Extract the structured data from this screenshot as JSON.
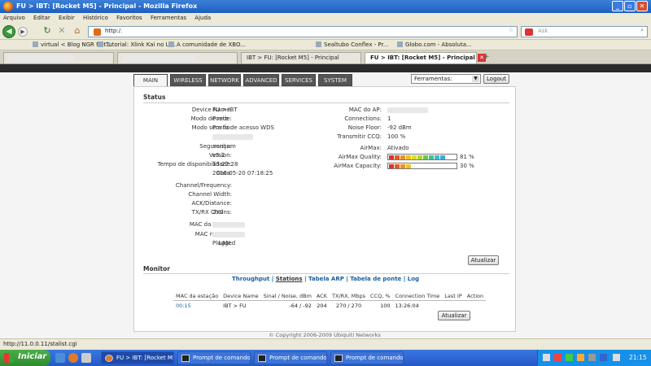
{
  "window": {
    "title": "FU > IBT: [Rocket M5] - Principal - Mozilla Firefox"
  },
  "menu": [
    "Arquivo",
    "Editar",
    "Exibir",
    "Histórico",
    "Favoritos",
    "Ferramentas",
    "Ajuda"
  ],
  "address": {
    "url": "http:/.",
    "search_placeholder": "Ask"
  },
  "bookmarks": [
    "virtual < Blog NGR Net...",
    "Tutorial: Xlink Kai no Li...",
    "A comunidade de XBO...",
    "Sealtubo Conflex - Pr...",
    "Globo.com - Absoluta..."
  ],
  "tabs": [
    {
      "label": "IBT > FU: [Rocket M5] - Principal"
    },
    {
      "label": "FU > IBT: [Rocket M5] - Principal"
    }
  ],
  "nav": {
    "tabs": [
      "MAIN",
      "WIRELESS",
      "NETWORK",
      "ADVANCED",
      "SERVICES",
      "SYSTEM"
    ],
    "tools_select": "Ferramentas:",
    "logout": "Logout"
  },
  "status": {
    "heading": "Status",
    "left": [
      {
        "label": "Device Name:",
        "value": "FU > IBT"
      },
      {
        "label": "Modo de rede:",
        "value": "Ponte"
      },
      {
        "label": "Modo sem fio:",
        "value": "Ponto de acesso WDS"
      },
      {
        "label": "SSID:",
        "value": ""
      },
      {
        "label": "Segurança:",
        "value": "nenhum"
      },
      {
        "label": "Version:",
        "value": "v5.2"
      },
      {
        "label": "Tempo de disponibilidade:",
        "value": "13:27:28"
      },
      {
        "label": "Data:",
        "value": "2010-05-20 07:18:25"
      },
      {
        "label": "Channel/Frequency:",
        "value": ""
      },
      {
        "label": "Channel Width:",
        "value": ""
      },
      {
        "label": "ACK/Distance:",
        "value": "-"
      },
      {
        "label": "TX/RX Chains:",
        "value": "2X2"
      },
      {
        "label": "MAC da WLAN:",
        "value": ""
      },
      {
        "label": "MAC na LAN:",
        "value": ""
      },
      {
        "label": "LAN:",
        "value": "Plugged"
      }
    ],
    "right": [
      {
        "label": "MAC do AP:",
        "value": ""
      },
      {
        "label": "Connections:",
        "value": "1"
      },
      {
        "label": "Noise Floor:",
        "value": "-92 dBm"
      },
      {
        "label": "Transmitir CCQ:",
        "value": "100 %"
      },
      {
        "label": "AirMax:",
        "value": "Ativado"
      }
    ],
    "airmax_quality": {
      "label": "AirMax Quality:",
      "value": "81 %",
      "level": 0.81
    },
    "airmax_capacity": {
      "label": "AirMax Capacity:",
      "value": "30 %",
      "level": 0.3
    },
    "refresh": "Atualizar"
  },
  "monitor": {
    "heading": "Monitor",
    "links": [
      "Throughput",
      "Stations",
      "Tabela ARP",
      "Tabela de ponte",
      "Log"
    ],
    "columns": [
      "MAC da estação",
      "Device Name",
      "Sinal / Noise, dBm",
      "ACK",
      "TX/RX, Mbps",
      "CCQ, %",
      "Connection Time",
      "Last IP",
      "Action"
    ],
    "row": {
      "mac": "00:15",
      "device": "IBT > FU",
      "signal": "-64 / -92",
      "ack": "204",
      "txrx": "270 / 270",
      "ccq": "100",
      "time": "13:26:04",
      "ip": "",
      "action": ""
    },
    "refresh": "Atualizar"
  },
  "copyright": "© Copyright 2006-2009 Ubiquiti Networks",
  "statusbar": "http://11.0.0.11/stalist.cgi",
  "taskbar": {
    "start": "Iniciar",
    "items": [
      "FU > IBT: [Rocket M5]...",
      "Prompt de comando -...",
      "Prompt de comando -...",
      "Prompt de comando -..."
    ],
    "clock": "21:15"
  },
  "colors": {
    "accent_link": "#1a5fa0",
    "title_bar": "#2a6ad0",
    "taskbar": "#2a5fd0"
  }
}
